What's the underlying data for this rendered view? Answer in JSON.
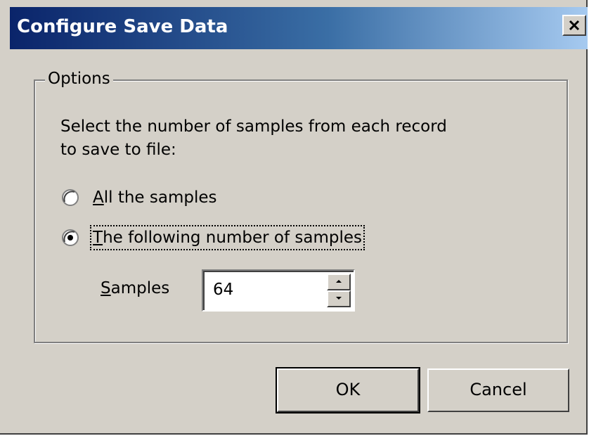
{
  "dialog": {
    "title": "Configure Save Data",
    "close_icon": "close-icon"
  },
  "options": {
    "legend": "Options",
    "instructions_line1": "Select the number of samples from each record",
    "instructions_line2": "to save to file:",
    "radio_all": {
      "mnemonic": "A",
      "rest": "ll the samples",
      "selected": false
    },
    "radio_following": {
      "mnemonic": "T",
      "rest": "he following number of samples",
      "selected": true
    },
    "samples": {
      "mnemonic": "S",
      "rest": "amples",
      "value": "64"
    }
  },
  "buttons": {
    "ok": "OK",
    "cancel": "Cancel"
  },
  "colors": {
    "title_gradient_start": "#0a246a",
    "title_gradient_end": "#a6caf0",
    "face": "#d4d0c8"
  }
}
